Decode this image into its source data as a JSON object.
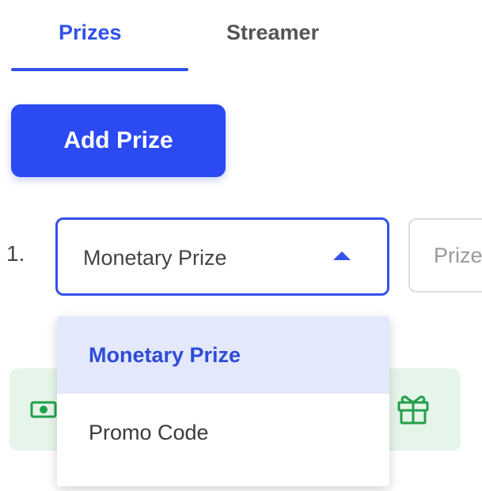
{
  "tabs": [
    {
      "label": "Prizes",
      "active": true
    },
    {
      "label": "Streamer",
      "active": false
    }
  ],
  "add_prize_button": {
    "label": "Add Prize"
  },
  "prize_row": {
    "number": "1.",
    "prize_type_select": {
      "value": "Monetary Prize",
      "expanded": true,
      "options": [
        {
          "label": "Monetary Prize",
          "selected": true
        },
        {
          "label": "Promo Code",
          "selected": false
        }
      ]
    },
    "prize_input": {
      "value": "",
      "placeholder": "Prize"
    }
  },
  "prize_card": {
    "icons": [
      "money-icon",
      "gift-icon"
    ]
  },
  "colors": {
    "accent": "#2b4af2",
    "tab_active": "#3052e8",
    "selected_option_bg": "#e3e8fb",
    "card_bg": "#e6f5ea",
    "card_icon": "#22a04a"
  }
}
